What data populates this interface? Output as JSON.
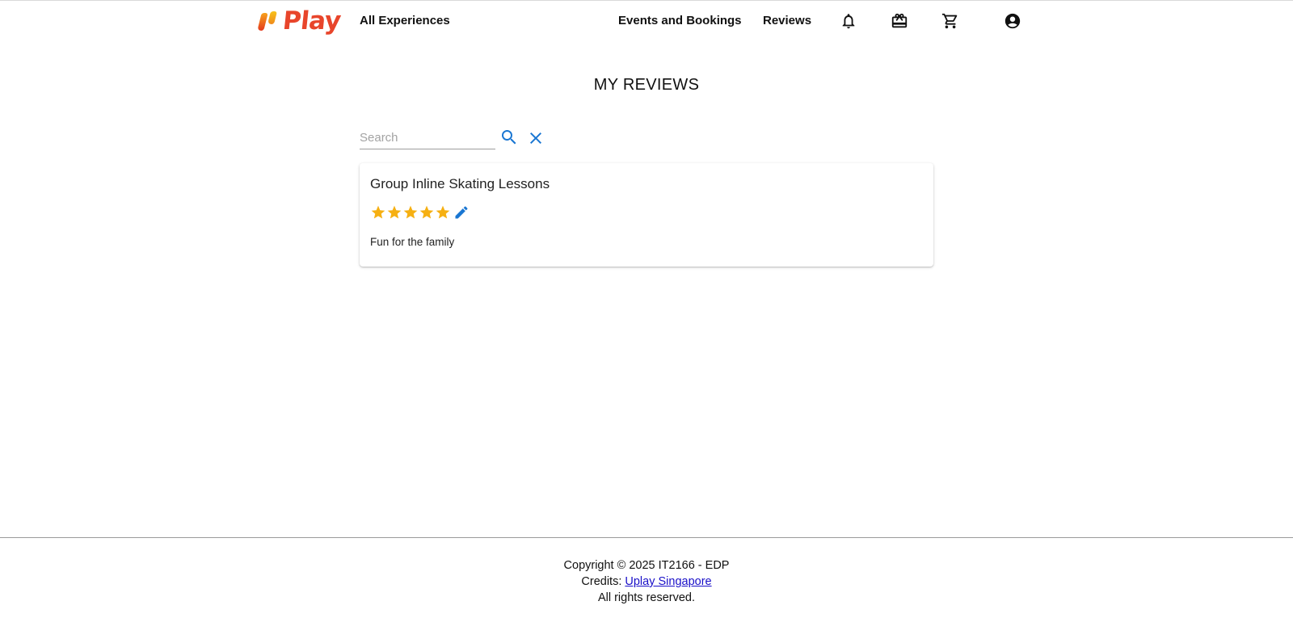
{
  "header": {
    "logo_text": "Play",
    "nav": {
      "all_experiences": "All Experiences",
      "events_and_bookings": "Events and Bookings",
      "reviews": "Reviews"
    },
    "icons": [
      "bell-icon",
      "gift-card-icon",
      "cart-icon",
      "account-icon"
    ]
  },
  "main": {
    "title": "MY REVIEWS",
    "search": {
      "placeholder": "Search",
      "value": ""
    },
    "reviews": [
      {
        "title": "Group Inline Skating Lessons",
        "rating": 5,
        "max_rating": 5,
        "text": "Fun for the family"
      }
    ]
  },
  "footer": {
    "copyright": "Copyright © 2025 IT2166 - EDP",
    "credits_prefix": "Credits: ",
    "credits_link": "Uplay Singapore",
    "rights": "All rights reserved."
  },
  "colors": {
    "brand": "#e8452b",
    "accent": "#1976d2",
    "star": "#f6b012",
    "link": "#1a10c8"
  }
}
